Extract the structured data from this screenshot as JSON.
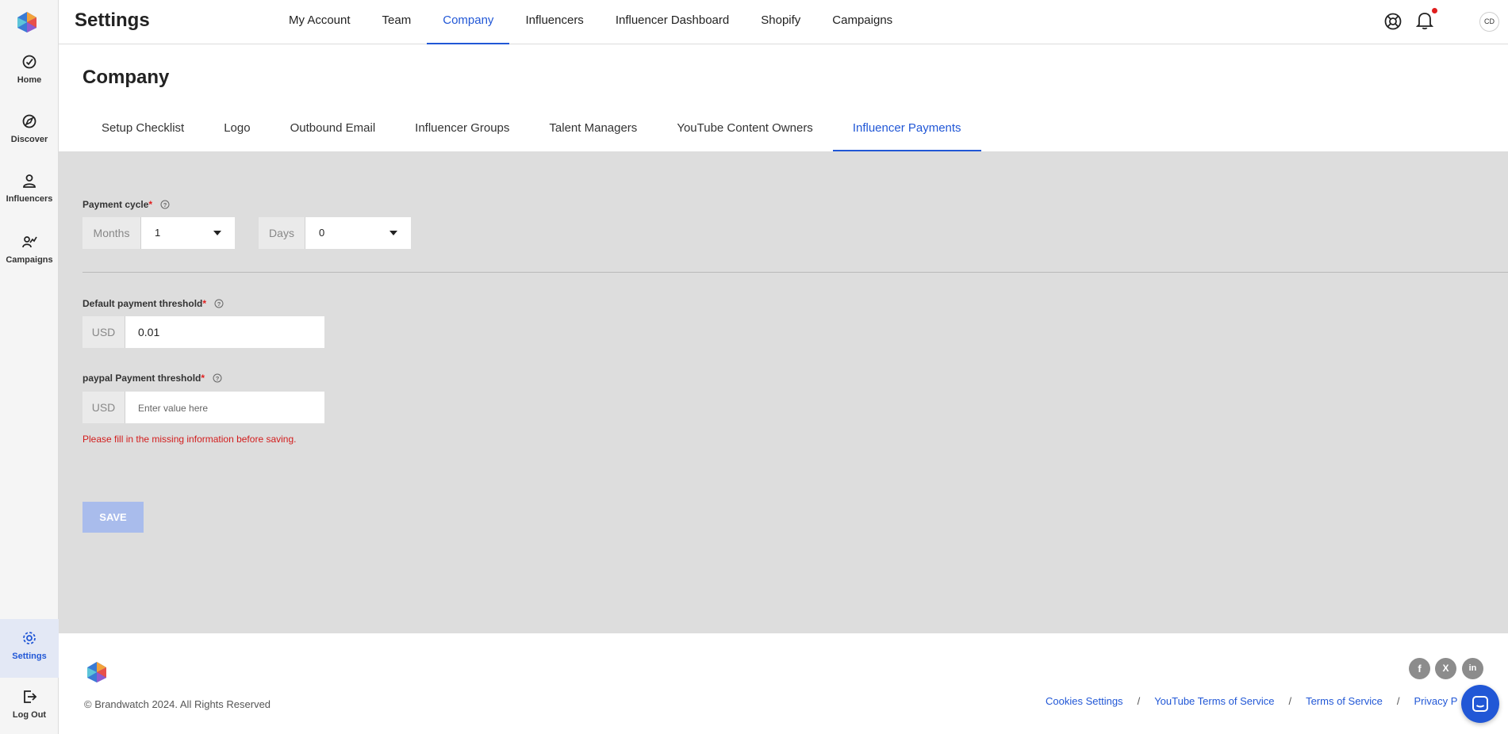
{
  "app": {
    "title": "Settings"
  },
  "sidebar": {
    "items": [
      {
        "label": "Home",
        "icon": "home-icon"
      },
      {
        "label": "Discover",
        "icon": "compass-icon"
      },
      {
        "label": "Influencers",
        "icon": "person-icon"
      },
      {
        "label": "Campaigns",
        "icon": "campaigns-icon"
      },
      {
        "label": "Settings",
        "icon": "gear-icon",
        "active": true
      },
      {
        "label": "Log Out",
        "icon": "logout-icon"
      }
    ]
  },
  "topnav": {
    "items": [
      {
        "label": "My Account"
      },
      {
        "label": "Team"
      },
      {
        "label": "Company",
        "active": true
      },
      {
        "label": "Influencers"
      },
      {
        "label": "Influencer Dashboard"
      },
      {
        "label": "Shopify"
      },
      {
        "label": "Campaigns"
      }
    ],
    "avatar_initials": "CD"
  },
  "page": {
    "title": "Company",
    "tabs": [
      {
        "label": "Setup Checklist"
      },
      {
        "label": "Logo"
      },
      {
        "label": "Outbound Email"
      },
      {
        "label": "Influencer Groups"
      },
      {
        "label": "Talent Managers"
      },
      {
        "label": "YouTube Content Owners"
      },
      {
        "label": "Influencer Payments",
        "active": true
      }
    ]
  },
  "form": {
    "payment_cycle": {
      "label": "Payment cycle",
      "required_mark": "*",
      "months_addon": "Months",
      "months_value": "1",
      "days_addon": "Days",
      "days_value": "0"
    },
    "default_threshold": {
      "label": "Default payment threshold",
      "required_mark": "*",
      "currency": "USD",
      "value": "0.01"
    },
    "paypal_threshold": {
      "label": "paypal Payment threshold",
      "required_mark": "*",
      "currency": "USD",
      "value": "",
      "placeholder": "Enter value here"
    },
    "error_message": "Please fill in the missing information before saving.",
    "save_label": "SAVE"
  },
  "footer": {
    "copyright": "© Brandwatch 2024. All Rights Reserved",
    "links": [
      "Cookies Settings",
      "YouTube Terms of Service",
      "Terms of Service",
      "Privacy P"
    ],
    "separator": "/",
    "social": [
      {
        "name": "facebook-icon",
        "glyph": "f"
      },
      {
        "name": "x-twitter-icon",
        "glyph": "X"
      },
      {
        "name": "linkedin-icon",
        "glyph": "in"
      }
    ]
  },
  "colors": {
    "accent": "#2157d6",
    "error": "#d21c1c",
    "content_bg": "#dddddd",
    "save_disabled": "#a9bcec"
  }
}
